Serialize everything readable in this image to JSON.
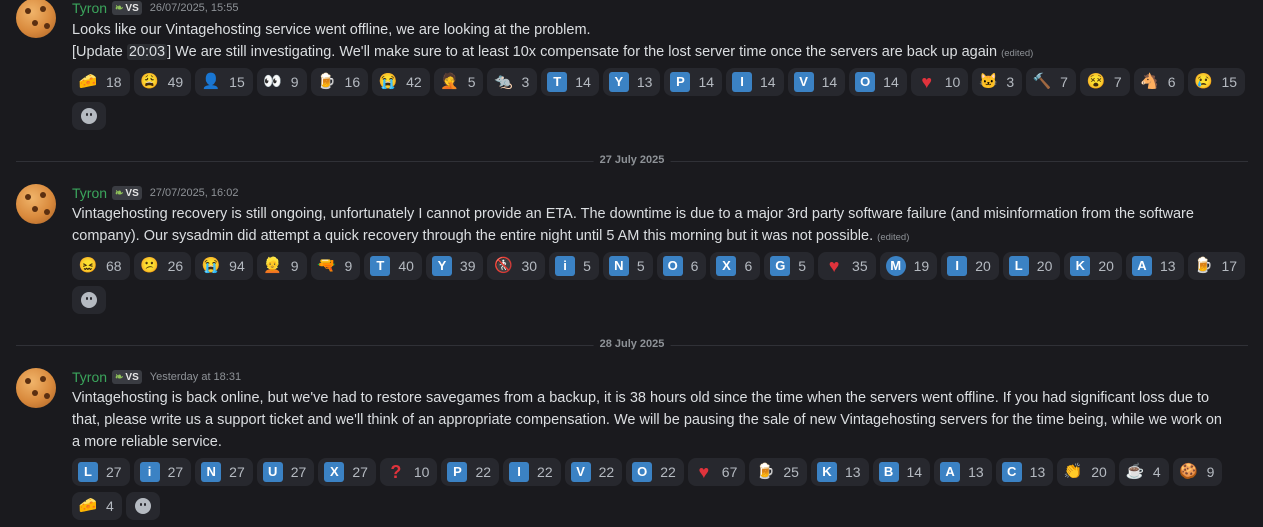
{
  "messages": [
    {
      "author": "Tyron",
      "tag": "VS",
      "timestamp": "26/07/2025, 15:55",
      "line1": "Looks like our Vintagehosting service went offline, we are looking at the problem.",
      "line2_pre": "[Update ",
      "line2_code": "20:03",
      "line2_post": "] We are still investigating. We'll make sure to at least 10x compensate for the lost server time once the servers are back up again",
      "edited": "(edited)",
      "reactions": [
        {
          "emoji": "cheese-emoji",
          "glyph": "🧀",
          "count": "18"
        },
        {
          "emoji": "weary-face-emoji",
          "glyph": "😩",
          "count": "49"
        },
        {
          "emoji": "anime-character-emoji",
          "glyph": "👤",
          "count": "15"
        },
        {
          "emoji": "eyes-emoji",
          "glyph": "👀",
          "count": "9"
        },
        {
          "emoji": "beer-emoji",
          "glyph": "🍺",
          "count": "16"
        },
        {
          "emoji": "crying-face-emoji",
          "glyph": "😭",
          "count": "42"
        },
        {
          "emoji": "facepalm-emoji",
          "glyph": "🤦",
          "count": "5"
        },
        {
          "emoji": "rat-emoji",
          "glyph": "🐀",
          "count": "3"
        },
        {
          "emoji": "letter-t-emoji",
          "glyph": "T",
          "count": "14",
          "letter": true
        },
        {
          "emoji": "letter-y-emoji",
          "glyph": "Y",
          "count": "13",
          "letter": true
        },
        {
          "emoji": "letter-p-emoji",
          "glyph": "P",
          "count": "14",
          "letter": true
        },
        {
          "emoji": "letter-i-emoji",
          "glyph": "I",
          "count": "14",
          "letter": true
        },
        {
          "emoji": "letter-v-emoji",
          "glyph": "V",
          "count": "14",
          "letter": true
        },
        {
          "emoji": "letter-o-emoji",
          "glyph": "O",
          "count": "14",
          "letter": true
        },
        {
          "emoji": "heart-emoji",
          "glyph": "♥",
          "count": "10",
          "heart": true
        },
        {
          "emoji": "cat-emoji",
          "glyph": "🐱",
          "count": "3"
        },
        {
          "emoji": "hammer-emoji",
          "glyph": "🔨",
          "count": "7"
        },
        {
          "emoji": "face-with-goggles-emoji",
          "glyph": "😵",
          "count": "7"
        },
        {
          "emoji": "horse-emoji",
          "glyph": "🐴",
          "count": "6"
        },
        {
          "emoji": "sad-tear-emoji",
          "glyph": "😢",
          "count": "15"
        }
      ]
    },
    {
      "author": "Tyron",
      "tag": "VS",
      "timestamp": "27/07/2025, 16:02",
      "line1": "Vintagehosting recovery is still ongoing, unfortunately I cannot provide an ETA. The downtime is due to a major 3rd party software failure (and misinformation from the software company). Our sysadmin did attempt a quick recovery through the entire night until 5 AM this morning but it was not possible.",
      "edited": "(edited)",
      "reactions": [
        {
          "emoji": "confounded-face-emoji",
          "glyph": "😖",
          "count": "68"
        },
        {
          "emoji": "confused-face-emoji",
          "glyph": "😕",
          "count": "26"
        },
        {
          "emoji": "crying-face-emoji",
          "glyph": "😭",
          "count": "94"
        },
        {
          "emoji": "person-emoji",
          "glyph": "👱",
          "count": "9"
        },
        {
          "emoji": "water-pistol-emoji",
          "glyph": "🔫",
          "count": "9"
        },
        {
          "emoji": "letter-t-emoji",
          "glyph": "T",
          "count": "40",
          "letter": true
        },
        {
          "emoji": "letter-y-emoji",
          "glyph": "Y",
          "count": "39",
          "letter": true
        },
        {
          "emoji": "no-pedestrians-emoji",
          "glyph": "🚷",
          "count": "30"
        },
        {
          "emoji": "letter-i-emoji",
          "glyph": "i",
          "count": "5",
          "letter": true
        },
        {
          "emoji": "letter-n-emoji",
          "glyph": "N",
          "count": "5",
          "letter": true
        },
        {
          "emoji": "letter-o-emoji",
          "glyph": "O",
          "count": "6",
          "letter": true
        },
        {
          "emoji": "letter-x-emoji",
          "glyph": "X",
          "count": "6",
          "letter": true
        },
        {
          "emoji": "letter-g-emoji",
          "glyph": "G",
          "count": "5",
          "letter": true
        },
        {
          "emoji": "heart-emoji",
          "glyph": "♥",
          "count": "35",
          "heart": true
        },
        {
          "emoji": "metro-m-emoji",
          "glyph": "M",
          "count": "19",
          "letter": true,
          "round": true
        },
        {
          "emoji": "letter-i-emoji",
          "glyph": "I",
          "count": "20",
          "letter": true
        },
        {
          "emoji": "letter-l-emoji",
          "glyph": "L",
          "count": "20",
          "letter": true
        },
        {
          "emoji": "letter-k-emoji",
          "glyph": "K",
          "count": "20",
          "letter": true
        },
        {
          "emoji": "letter-a-emoji",
          "glyph": "A",
          "count": "13",
          "letter": true
        },
        {
          "emoji": "beer-emoji",
          "glyph": "🍺",
          "count": "17"
        }
      ]
    },
    {
      "author": "Tyron",
      "tag": "VS",
      "timestamp": "Yesterday at 18:31",
      "line1": "Vintagehosting is back online, but we've had to restore savegames from a backup, it is 38 hours old since the time when the servers went offline. If you had significant loss due to that, please write us a support ticket and we'll think of an appropriate compensation. We will be pausing the sale of new Vintagehosting servers for the time being, while we work on a more reliable service.",
      "reactions": [
        {
          "emoji": "letter-l-emoji",
          "glyph": "L",
          "count": "27",
          "letter": true
        },
        {
          "emoji": "letter-i-emoji",
          "glyph": "i",
          "count": "27",
          "letter": true
        },
        {
          "emoji": "letter-n-emoji",
          "glyph": "N",
          "count": "27",
          "letter": true
        },
        {
          "emoji": "letter-u-emoji",
          "glyph": "U",
          "count": "27",
          "letter": true
        },
        {
          "emoji": "letter-x-emoji",
          "glyph": "X",
          "count": "27",
          "letter": true
        },
        {
          "emoji": "question-mark-emoji",
          "glyph": "?",
          "count": "10",
          "qmark": true
        },
        {
          "emoji": "letter-p-emoji",
          "glyph": "P",
          "count": "22",
          "letter": true
        },
        {
          "emoji": "letter-i-emoji",
          "glyph": "I",
          "count": "22",
          "letter": true
        },
        {
          "emoji": "letter-v-emoji",
          "glyph": "V",
          "count": "22",
          "letter": true
        },
        {
          "emoji": "letter-o-emoji",
          "glyph": "O",
          "count": "22",
          "letter": true
        },
        {
          "emoji": "heart-emoji",
          "glyph": "♥",
          "count": "67",
          "heart": true
        },
        {
          "emoji": "beer-emoji",
          "glyph": "🍺",
          "count": "25"
        },
        {
          "emoji": "letter-k-emoji",
          "glyph": "K",
          "count": "13",
          "letter": true
        },
        {
          "emoji": "letter-b-emoji",
          "glyph": "B",
          "count": "14",
          "letter": true
        },
        {
          "emoji": "letter-a-emoji",
          "glyph": "A",
          "count": "13",
          "letter": true
        },
        {
          "emoji": "letter-c-emoji",
          "glyph": "C",
          "count": "13",
          "letter": true
        },
        {
          "emoji": "clapping-hands-emoji",
          "glyph": "👏",
          "count": "20"
        },
        {
          "emoji": "hot-beverage-emoji",
          "glyph": "☕",
          "count": "4"
        },
        {
          "emoji": "cookie-emoji",
          "glyph": "🍪",
          "count": "9"
        },
        {
          "emoji": "cheese-emoji",
          "glyph": "🧀",
          "count": "4"
        }
      ]
    }
  ],
  "dividers": [
    "27 July 2025",
    "28 July 2025"
  ],
  "colors": {
    "author": "#3ba55c",
    "letter_badge": "#3b82c4",
    "heart": "#e0333c",
    "background": "#1a1a1e"
  }
}
